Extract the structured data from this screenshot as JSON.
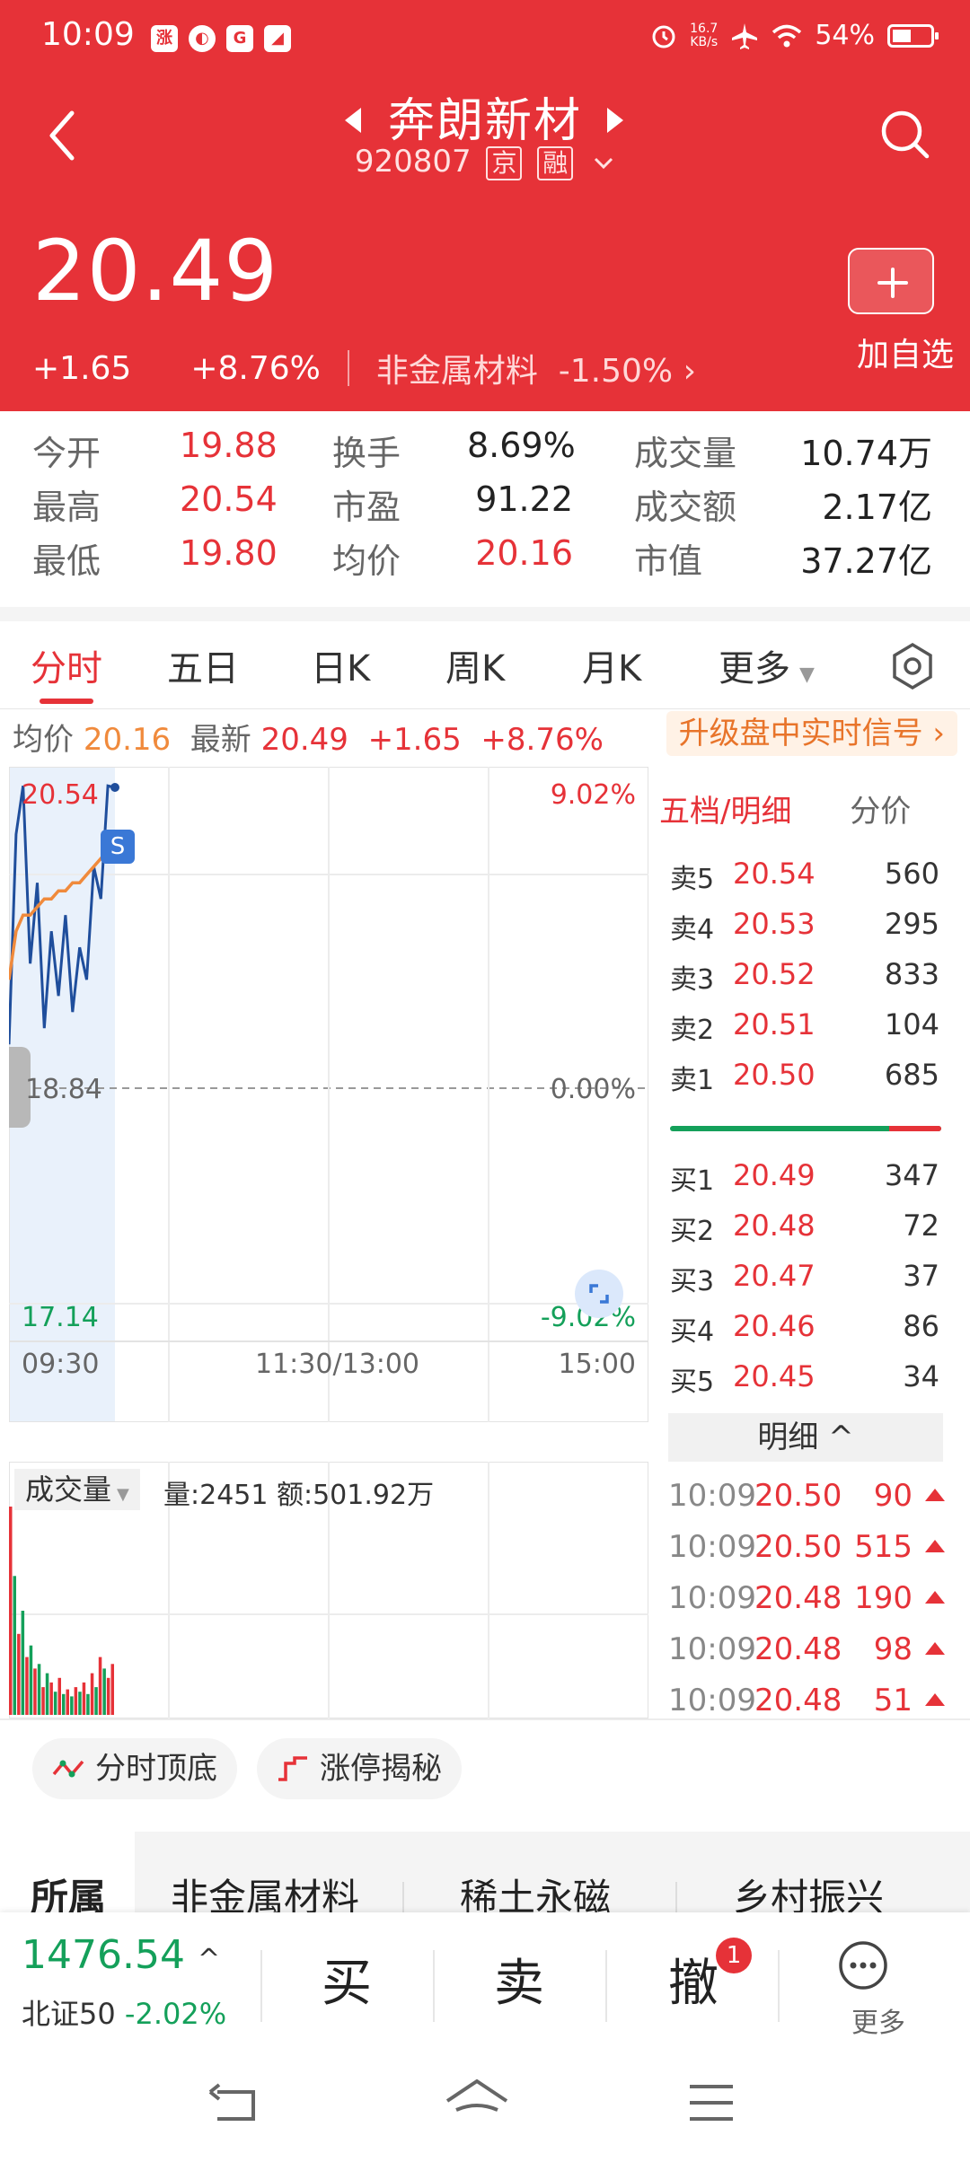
{
  "status_bar": {
    "time": "10:09",
    "speed_top": "16.7",
    "speed_bottom": "KB/s",
    "battery": "54%"
  },
  "header": {
    "stock_name": "奔朗新材",
    "code": "920807",
    "tag_exchange": "京",
    "tag_margin": "融",
    "price": "20.49",
    "change": "+1.65",
    "change_pct": "+8.76%",
    "sector_name": "非金属材料",
    "sector_pct": "-1.50%",
    "sector_arrow": "›",
    "add_fav_label": "加自选"
  },
  "stats": {
    "rows": [
      [
        {
          "label": "今开",
          "value": "19.88"
        },
        {
          "label": "换手",
          "value": "8.69%"
        },
        {
          "label": "成交量",
          "value": "10.74万"
        }
      ],
      [
        {
          "label": "最高",
          "value": "20.54"
        },
        {
          "label": "市盈",
          "value": "91.22"
        },
        {
          "label": "成交额",
          "value": "2.17亿"
        }
      ],
      [
        {
          "label": "最低",
          "value": "19.80"
        },
        {
          "label": "均价",
          "value": "20.16"
        },
        {
          "label": "市值",
          "value": "37.27亿"
        }
      ]
    ]
  },
  "tabs": [
    "分时",
    "五日",
    "日K",
    "周K",
    "月K",
    "更多"
  ],
  "info_line": {
    "avg_label": "均价",
    "avg_value": "20.16",
    "latest_label": "最新",
    "latest_value": "20.49",
    "change": "+1.65",
    "change_pct": "+8.76%",
    "signal_label": "升级盘中实时信号 ›"
  },
  "chart": {
    "price_high": "20.54",
    "price_mid": "18.84",
    "price_low": "17.14",
    "pct_high": "9.02%",
    "pct_mid": "0.00%",
    "pct_low": "-9.02%",
    "time_start": "09:30",
    "time_mid": "11:30/13:00",
    "time_end": "15:00",
    "s_marker": "S",
    "volume_selector": "成交量",
    "volume_info": "量:2451 额:501.92万"
  },
  "chart_data": {
    "type": "line",
    "x_range": [
      "09:30",
      "15:00"
    ],
    "ylim": [
      17.14,
      20.54
    ],
    "series": [
      {
        "values": [
          18.9,
          20.2,
          20.5,
          19.4,
          19.9,
          19.0,
          19.6,
          19.2,
          19.7,
          19.1,
          19.5,
          19.3,
          20.0,
          19.8,
          20.5,
          20.49
        ]
      },
      {
        "values": [
          19.3,
          19.6,
          19.7,
          19.7,
          19.75,
          19.8,
          19.8,
          19.85,
          19.85,
          19.9,
          19.9,
          19.95,
          20.0,
          20.05,
          20.1,
          20.16
        ]
      }
    ],
    "volume": [
      {
        "value": 90,
        "dir": "up"
      },
      {
        "value": 60,
        "dir": "down"
      },
      {
        "value": 35,
        "dir": "up"
      },
      {
        "value": 45,
        "dir": "down"
      },
      {
        "value": 25,
        "dir": "up"
      },
      {
        "value": 30,
        "dir": "down"
      },
      {
        "value": 20,
        "dir": "up"
      },
      {
        "value": 22,
        "dir": "down"
      },
      {
        "value": 12,
        "dir": "up"
      },
      {
        "value": 18,
        "dir": "down"
      },
      {
        "value": 14,
        "dir": "up"
      },
      {
        "value": 10,
        "dir": "down"
      },
      {
        "value": 16,
        "dir": "up"
      },
      {
        "value": 9,
        "dir": "down"
      },
      {
        "value": 11,
        "dir": "up"
      },
      {
        "value": 8,
        "dir": "down"
      },
      {
        "value": 12,
        "dir": "up"
      },
      {
        "value": 10,
        "dir": "down"
      },
      {
        "value": 14,
        "dir": "up"
      },
      {
        "value": 9,
        "dir": "down"
      },
      {
        "value": 18,
        "dir": "up"
      },
      {
        "value": 12,
        "dir": "down"
      },
      {
        "value": 25,
        "dir": "up"
      },
      {
        "value": 20,
        "dir": "down"
      },
      {
        "value": 16,
        "dir": "up"
      },
      {
        "value": 22,
        "dir": "up"
      }
    ]
  },
  "order_book": {
    "title": "五档/明细",
    "tab_price": "分价",
    "sells": [
      {
        "label": "卖5",
        "price": "20.54",
        "vol": "560"
      },
      {
        "label": "卖4",
        "price": "20.53",
        "vol": "295"
      },
      {
        "label": "卖3",
        "price": "20.52",
        "vol": "833"
      },
      {
        "label": "卖2",
        "price": "20.51",
        "vol": "104"
      },
      {
        "label": "卖1",
        "price": "20.50",
        "vol": "685"
      }
    ],
    "buys": [
      {
        "label": "买1",
        "price": "20.49",
        "vol": "347"
      },
      {
        "label": "买2",
        "price": "20.48",
        "vol": "72"
      },
      {
        "label": "买3",
        "price": "20.47",
        "vol": "37"
      },
      {
        "label": "买4",
        "price": "20.46",
        "vol": "86"
      },
      {
        "label": "买5",
        "price": "20.45",
        "vol": "34"
      }
    ],
    "detail_label": "明细 ^",
    "ticks": [
      {
        "time": "10:09",
        "price": "20.50",
        "vol": "90"
      },
      {
        "time": "10:09",
        "price": "20.50",
        "vol": "515"
      },
      {
        "time": "10:09",
        "price": "20.48",
        "vol": "190"
      },
      {
        "time": "10:09",
        "price": "20.48",
        "vol": "98"
      },
      {
        "time": "10:09",
        "price": "20.48",
        "vol": "51"
      }
    ]
  },
  "chips": {
    "top_bottom": "分时顶底",
    "limit_up": "涨停揭秘"
  },
  "sector_tabs": [
    "所属",
    "非金属材料",
    "稀土永磁",
    "乡村振兴"
  ],
  "bottom_bar": {
    "index_value": "1476.54",
    "index_arrow": "^",
    "index_name": "北证50",
    "index_pct": "-2.02%",
    "buy": "买",
    "sell": "卖",
    "cancel": "撤",
    "cancel_badge": "1",
    "more": "更多"
  },
  "colors": {
    "brand_red": "#e63238",
    "down_green": "#14a05a",
    "avg_orange": "#f08a3c",
    "price_line": "#1f4e9c"
  }
}
